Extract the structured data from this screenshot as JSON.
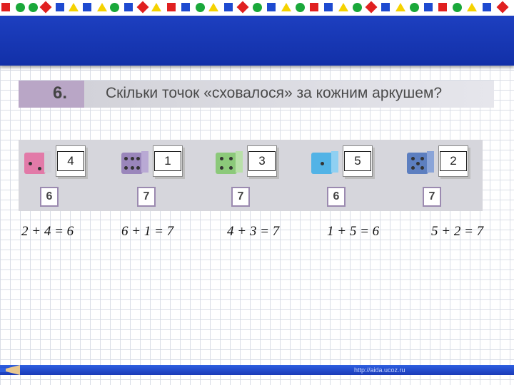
{
  "task": {
    "number": "6.",
    "title": "Скільки точок «сховалося» за кожним аркушем?"
  },
  "dice": [
    {
      "hidden": "4",
      "total": "6",
      "cube_color": "#e27aa8",
      "side_color": "#d1d1d8",
      "pips": 2
    },
    {
      "hidden": "1",
      "total": "7",
      "cube_color": "#9a86bb",
      "side_color": "#b9a9d4",
      "pips": 6
    },
    {
      "hidden": "3",
      "total": "7",
      "cube_color": "#8cc97a",
      "side_color": "#b8e0a8",
      "pips": 4
    },
    {
      "hidden": "5",
      "total": "6",
      "cube_color": "#52b3e6",
      "side_color": "#8fd0f2",
      "pips": 1
    },
    {
      "hidden": "2",
      "total": "7",
      "cube_color": "#5d7fc0",
      "side_color": "#8aa4d8",
      "pips": 5
    }
  ],
  "equations": [
    "2 + 4  = 6",
    "6  +  1 = 7",
    "4  +  3 = 7",
    "1  +  5 = 6",
    "5  +  2 = 7"
  ],
  "footer": {
    "watermark": "http://aida.ucoz.ru"
  },
  "colors": {
    "header_band": "#1d3fc0",
    "bottom_bar": "#2e5fe0"
  },
  "decor_shapes": [
    "red-square-icon",
    "green-circle-icon",
    "yellow-triangle-icon",
    "blue-cube-icon"
  ]
}
